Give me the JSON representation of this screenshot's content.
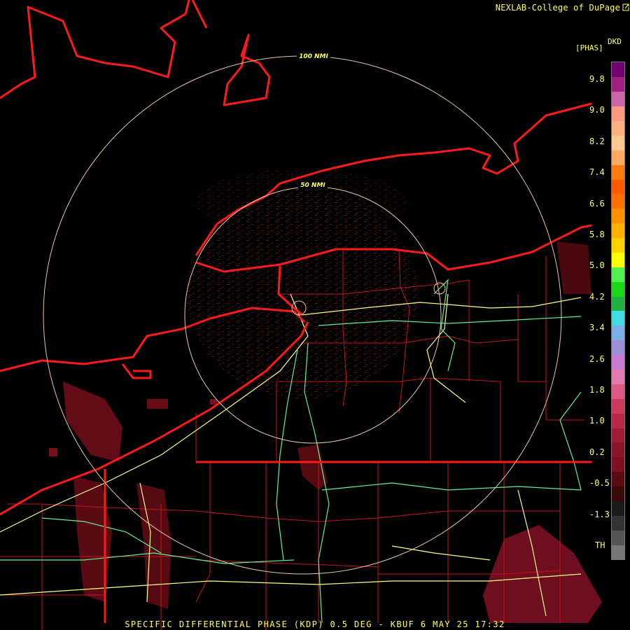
{
  "header": {
    "credit": "NEXLAB-College of DuPage",
    "credit_icon": "external-link-icon"
  },
  "rings": [
    {
      "label": "100 NMI"
    },
    {
      "label": "50 NMI"
    }
  ],
  "legend": {
    "unit_top": "DKD",
    "unit": "[PHAS]",
    "ticks": [
      "9.8",
      "9.0",
      "8.2",
      "7.4",
      "6.6",
      "5.8",
      "5.0",
      "4.2",
      "3.4",
      "2.6",
      "1.8",
      "1.0",
      "0.2",
      "-0.5",
      "-1.3",
      "TH"
    ],
    "colors": [
      "#777777",
      "#555555",
      "#333333",
      "#1a1a1a",
      "#3a0a0a",
      "#5a0b12",
      "#7a1020",
      "#8a1428",
      "#a01c38",
      "#b82846",
      "#cc3a5c",
      "#dd5a86",
      "#e07ab0",
      "#c77ad0",
      "#9a8fd8",
      "#7ab0e8",
      "#40dde0",
      "#20b040",
      "#18d818",
      "#50f050",
      "#ffff00",
      "#ffd000",
      "#ffb000",
      "#ff9000",
      "#ff7000",
      "#ff5a00",
      "#ff7a10",
      "#ffaa60",
      "#ffc890",
      "#ffb080",
      "#ff9a80",
      "#cc66aa",
      "#a02080",
      "#700070"
    ]
  },
  "caption": "SPECIFIC DIFFERENTIAL PHASE (KDP) 0.5 DEG - KBUF 6 MAY 25 17:32",
  "colors": {
    "boundary": "#ff1a1a",
    "county": "#c01818",
    "highway_a": "#ffff88",
    "highway_b": "#66ee99",
    "ring": "#e8c8a0",
    "echo": "#8a1020"
  }
}
